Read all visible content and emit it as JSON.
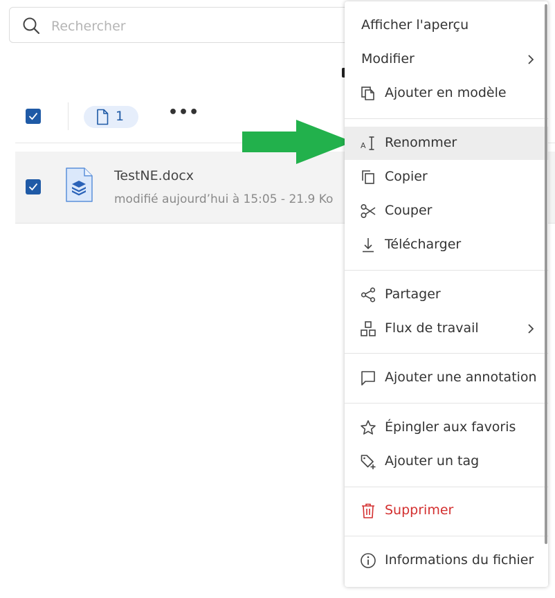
{
  "search": {
    "placeholder": "Rechercher"
  },
  "toolbar": {
    "selected_count": "1",
    "more": "•••"
  },
  "file": {
    "name": "TestNE.docx",
    "meta": "modifié aujourd’hui à 15:05  -  21.9 Ko"
  },
  "colors": {
    "accent": "#1f5aa6",
    "danger": "#d32f2f",
    "arrow": "#22b14c"
  },
  "menu": {
    "items": [
      {
        "id": "preview",
        "label": "Afficher l'aperçu",
        "icon": "none"
      },
      {
        "id": "modify",
        "label": "Modifier",
        "icon": "chevron-right-icon"
      },
      {
        "id": "template",
        "label": "Ajouter en modèle",
        "icon": "copy-template-icon"
      },
      {
        "id": "rename",
        "label": "Renommer",
        "icon": "text-cursor-icon",
        "highlighted": true
      },
      {
        "id": "copy",
        "label": "Copier",
        "icon": "copy-icon"
      },
      {
        "id": "cut",
        "label": "Couper",
        "icon": "scissors-icon"
      },
      {
        "id": "download",
        "label": "Télécharger",
        "icon": "download-icon"
      },
      {
        "id": "share",
        "label": "Partager",
        "icon": "share-icon"
      },
      {
        "id": "workflow",
        "label": "Flux de travail",
        "icon": "workflow-icon"
      },
      {
        "id": "annotate",
        "label": "Ajouter une annotation",
        "icon": "comment-icon"
      },
      {
        "id": "pin",
        "label": "Épingler aux favoris",
        "icon": "star-icon"
      },
      {
        "id": "tag",
        "label": "Ajouter un tag",
        "icon": "tag-icon"
      },
      {
        "id": "delete",
        "label": "Supprimer",
        "icon": "trash-icon"
      },
      {
        "id": "info",
        "label": "Informations du fichier",
        "icon": "info-icon"
      }
    ]
  }
}
